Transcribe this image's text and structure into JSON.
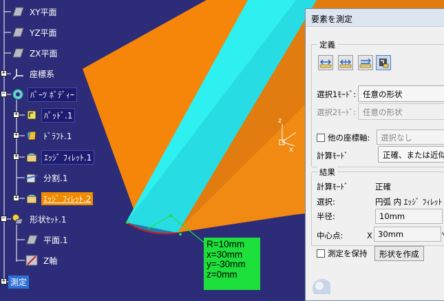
{
  "tree": {
    "items": [
      {
        "label": "XY平面",
        "icon": "plane-icon"
      },
      {
        "label": "YZ平面",
        "icon": "plane-icon"
      },
      {
        "label": "ZX平面",
        "icon": "plane-icon"
      },
      {
        "label": "座標系",
        "icon": "axis-system-icon"
      },
      {
        "label": "ﾊﾟｰﾂ ﾎﾞﾃﾞｨｰ",
        "icon": "part-body-icon"
      },
      {
        "label": "ﾊﾟｯﾄﾞ.1",
        "icon": "pad-icon"
      },
      {
        "label": "ﾄﾞﾗﾌﾄ.1",
        "icon": "draft-icon"
      },
      {
        "label": "ｴｯｼﾞ ﾌｨﾚｯﾄ.1",
        "icon": "edge-fillet-icon"
      },
      {
        "label": "分割.1",
        "icon": "split-icon"
      },
      {
        "label": "ｴｯｼﾞ ﾌｨﾚｯﾄ.2",
        "icon": "edge-fillet-icon"
      },
      {
        "label": "形状ｾｯﾄ.1",
        "icon": "geometrical-set-icon"
      },
      {
        "label": "平面.1",
        "icon": "plane-icon"
      },
      {
        "label": "Z軸",
        "icon": "line-icon"
      },
      {
        "label": "測定",
        "icon": "measure-icon"
      }
    ]
  },
  "measure_label": {
    "lines": [
      "R=10mm",
      "x=30mm",
      "y=-30mm",
      "z=0mm"
    ]
  },
  "dialog": {
    "title": "要素を測定",
    "definition": {
      "title": "定義",
      "select1_label": "選択1ﾓｰﾄﾞ:",
      "select1_value": "任意の形状",
      "select2_label": "選択2ﾓｰﾄﾞ:",
      "select2_value": "任意の形状",
      "other_axis_label": "他の座標軸:",
      "other_axis_value": "選択なし",
      "calc_mode_label": "計算ﾓｰﾄﾞ",
      "calc_mode_value": "正確、または近似"
    },
    "result": {
      "title": "結果",
      "calc_mode_label": "計算ﾓｰﾄﾞ",
      "calc_mode_value": "正確",
      "selection_label": "選択:",
      "selection_value": "円弧 内 ｴｯｼﾞ ﾌｨﾚｯﾄ",
      "radius_label": "半径:",
      "radius_value": "10mm",
      "center_label": "中心点:",
      "x_label": "X",
      "x_value": "30mm",
      "y_label": "Y"
    },
    "keep_measure_label": "測定を保持",
    "create_geometry_label": "形状を作成"
  },
  "compass": {
    "z_label": "z",
    "x_label": "x"
  },
  "colors": {
    "background": "#2c2c78",
    "part_orange": "#f5860a",
    "fillet_cyan": "#2ef0f0",
    "measure_box": "#1ee03c"
  }
}
